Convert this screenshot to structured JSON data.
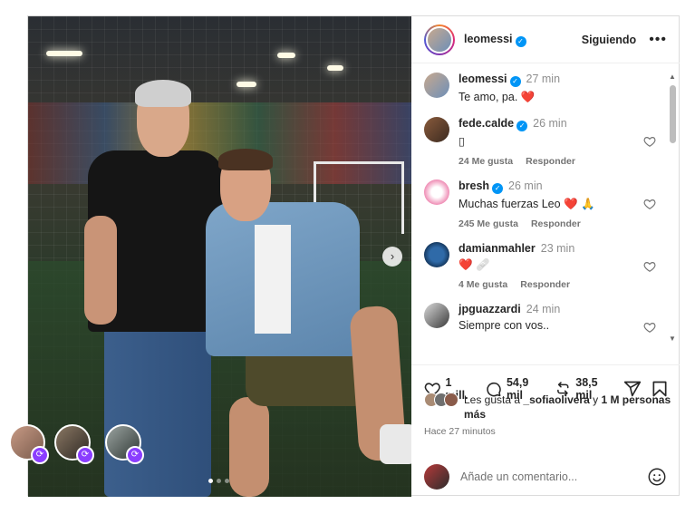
{
  "header": {
    "username": "leomessi",
    "follow_label": "Siguiendo",
    "more_label": "•••"
  },
  "photo": {
    "next_label": "›",
    "carousel_count": 3,
    "carousel_active": 1
  },
  "comments": [
    {
      "username": "leomessi",
      "verified": true,
      "time": "27 min",
      "text": "Te amo, pa. ❤️"
    },
    {
      "username": "fede.calde",
      "verified": true,
      "time": "26 min",
      "text": "▯",
      "likes": "24 Me gusta",
      "reply": "Responder"
    },
    {
      "username": "bresh",
      "verified": true,
      "time": "26 min",
      "text": "Muchas fuerzas Leo ❤️ 🙏",
      "likes": "245 Me gusta",
      "reply": "Responder"
    },
    {
      "username": "damianmahler",
      "verified": false,
      "time": "23 min",
      "text": "❤️ 🩹",
      "likes": "4 Me gusta",
      "reply": "Responder"
    },
    {
      "username": "jpguazzardi",
      "verified": false,
      "time": "24 min",
      "text": "Siempre con vos.."
    }
  ],
  "actions": {
    "likes_count": "1 mill.",
    "comments_count": "54,9 mil",
    "reposts_count": "38,5 mil"
  },
  "likes_line": {
    "prefix": "Les gusta a ",
    "user": "_sofiaolivera",
    "suffix": " y ",
    "others": "1 M personas más"
  },
  "posted_ago": "Hace 27 minutos",
  "add_comment": {
    "placeholder": "Añade un comentario..."
  },
  "colors": {
    "verified": "#0095f6",
    "heart": "#ed1c24",
    "repost_badge": "#8b3dff",
    "muted": "#737373"
  },
  "icons": [
    "heart-icon",
    "comment-icon",
    "repost-icon",
    "share-icon",
    "bookmark-icon",
    "emoji-icon",
    "verified-icon",
    "more-icon",
    "chevron-right-icon"
  ]
}
